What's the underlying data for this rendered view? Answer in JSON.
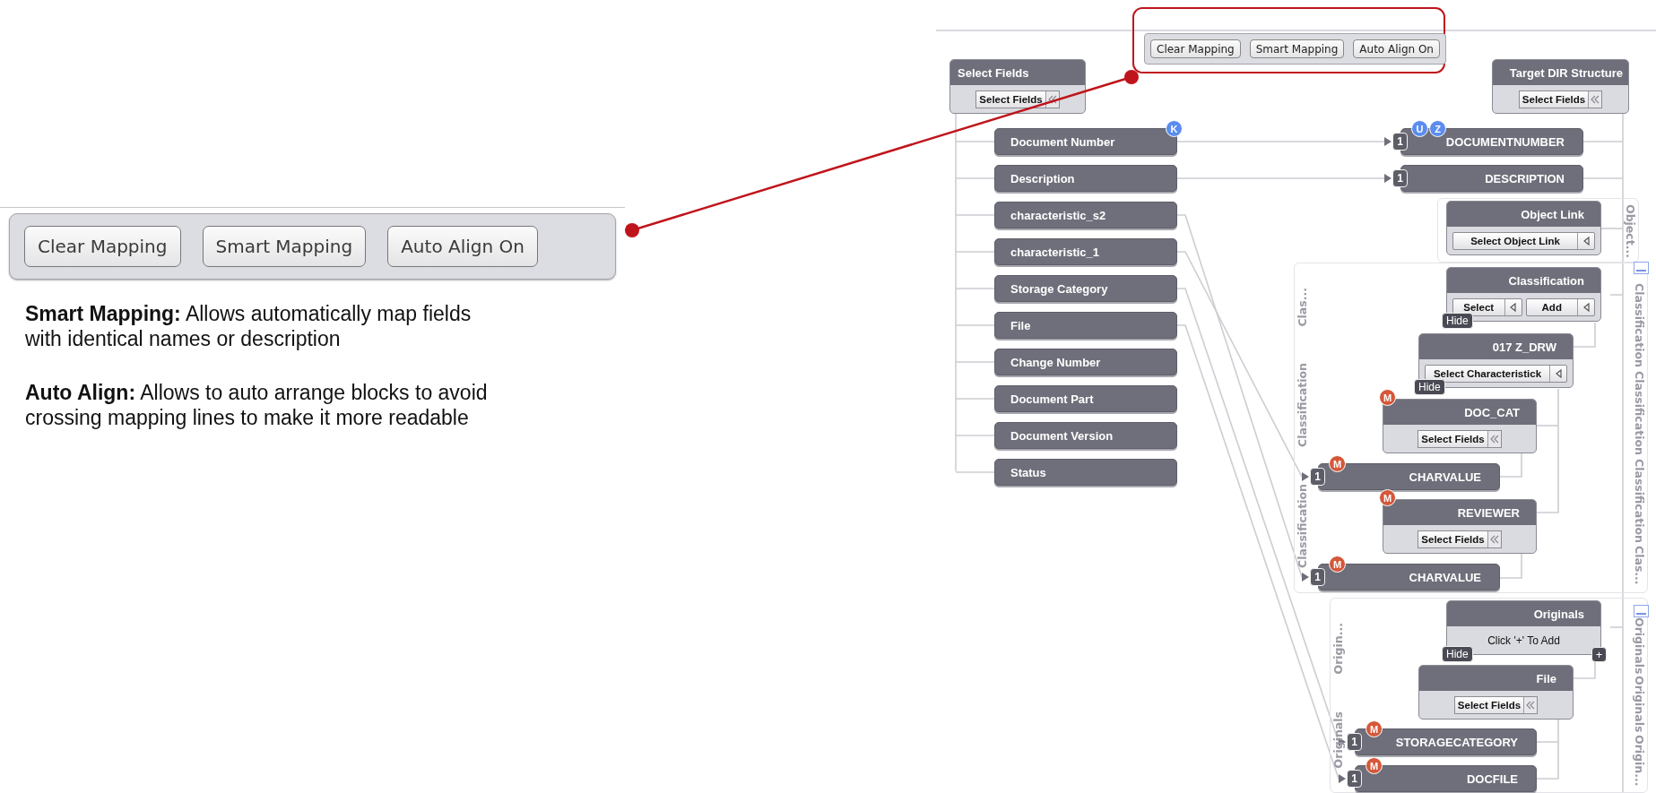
{
  "help": {
    "toolbar": [
      {
        "label": "Clear Mapping"
      },
      {
        "label": "Smart Mapping"
      },
      {
        "label": "Auto Align On"
      }
    ],
    "notes": [
      "**Smart Mapping:** Allows automatically map fields with identical names or description",
      "**Auto Align:** Allows to auto arrange blocks to avoid crossing mapping lines to make it more readable"
    ]
  },
  "mapper": {
    "toolbar": [
      {
        "label": "Clear Mapping"
      },
      {
        "label": "Smart Mapping"
      },
      {
        "label": "Auto Align On"
      }
    ],
    "source": {
      "title": "Select Fields",
      "picker": "Select Fields"
    },
    "source_fields": [
      {
        "label": "Document Number",
        "badges": [
          {
            "text": "K",
            "color": "#5b8cf0"
          }
        ]
      },
      {
        "label": "Description"
      },
      {
        "label": "characteristic_s2"
      },
      {
        "label": "characteristic_1"
      },
      {
        "label": "Storage Category"
      },
      {
        "label": "File"
      },
      {
        "label": "Change Number"
      },
      {
        "label": "Document Part"
      },
      {
        "label": "Document Version"
      },
      {
        "label": "Status"
      }
    ],
    "target": {
      "title": "Target DIR Structure",
      "picker": "Select Fields"
    },
    "groups": [
      {
        "right_labels": [
          "Object..."
        ]
      },
      {
        "left_labels": [
          "Clas...",
          "Classification",
          "Classification"
        ],
        "right_labels": [
          "Classification",
          "Classification",
          "Classification",
          "Clas..."
        ]
      },
      {
        "left_labels": [
          "Origin...",
          "Originals"
        ],
        "right_labels": [
          "Originals",
          "Originals",
          "Origin..."
        ]
      }
    ],
    "target_nodes": [
      {
        "kind": "field",
        "label": "DOCUMENTNUMBER",
        "count": "1",
        "badges": [
          {
            "text": "U",
            "color": "#5b8cf0"
          },
          {
            "text": "Z",
            "color": "#5b8cf0"
          }
        ]
      },
      {
        "kind": "field",
        "label": "DESCRIPTION",
        "count": "1"
      },
      {
        "kind": "block",
        "title": "Object Link",
        "controls": [
          {
            "kind": "dropdown",
            "label": "Select Object Link"
          }
        ]
      },
      {
        "kind": "block",
        "title": "Classification",
        "controls": [
          {
            "kind": "dropdown",
            "label": "Select"
          },
          {
            "kind": "dropdown",
            "label": "Add"
          }
        ],
        "hide": "Hide"
      },
      {
        "kind": "block",
        "title": "017 Z_DRW",
        "controls": [
          {
            "kind": "dropdown",
            "label": "Select Characteristick"
          }
        ],
        "hide": "Hide"
      },
      {
        "kind": "block",
        "title": "DOC_CAT",
        "badges": [
          {
            "text": "M",
            "color": "#d5583a"
          }
        ],
        "controls": [
          {
            "kind": "picker",
            "label": "Select Fields"
          }
        ]
      },
      {
        "kind": "field",
        "label": "CHARVALUE",
        "count": "1",
        "badges": [
          {
            "text": "M",
            "color": "#d5583a"
          }
        ]
      },
      {
        "kind": "block",
        "title": "REVIEWER",
        "badges": [
          {
            "text": "M",
            "color": "#d5583a"
          }
        ],
        "controls": [
          {
            "kind": "picker",
            "label": "Select Fields"
          }
        ]
      },
      {
        "kind": "field",
        "label": "CHARVALUE",
        "count": "1",
        "badges": [
          {
            "text": "M",
            "color": "#d5583a"
          }
        ]
      },
      {
        "kind": "block",
        "title": "Originals",
        "hint": "Click '+' To Add",
        "hide": "Hide",
        "add": "+"
      },
      {
        "kind": "block",
        "title": "File",
        "controls": [
          {
            "kind": "picker",
            "label": "Select Fields"
          }
        ]
      },
      {
        "kind": "field",
        "label": "STORAGECATEGORY",
        "count": "1",
        "badges": [
          {
            "text": "M",
            "color": "#d5583a"
          }
        ]
      },
      {
        "kind": "field",
        "label": "DOCFILE",
        "count": "1",
        "badges": [
          {
            "text": "M",
            "color": "#d5583a"
          }
        ]
      }
    ]
  }
}
